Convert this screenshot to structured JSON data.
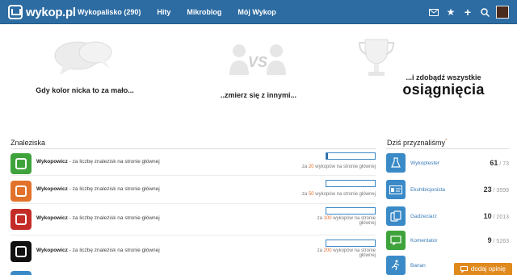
{
  "header": {
    "logo": "wykop.pl",
    "nav": [
      "Wykopalisko (290)",
      "Hity",
      "Mikroblog",
      "Mój Wykop"
    ],
    "icons": [
      "mail-icon",
      "star-icon",
      "plus-icon",
      "search-icon",
      "avatar"
    ]
  },
  "hero": {
    "caption1": "Gdy kolor nicka to za mało...",
    "caption2": "..zmierz się z innymi...",
    "caption3_small": "...i zdobądź wszystkie",
    "caption3_big": "osiągnięcia",
    "vs_label": "VS"
  },
  "left": {
    "title": "Znaleziska",
    "rows": [
      {
        "name": "Wykopowicz",
        "desc": " - za liczbę znalezisk na stronie głównej",
        "pre": "za ",
        "num": "20",
        "post": " wykopów na stronie głównej",
        "progress": 0.03,
        "color": "#3fa33b"
      },
      {
        "name": "Wykopowicz",
        "desc": " - za liczbę znalezisk na stronie głównej",
        "pre": "za ",
        "num": "50",
        "post": " wykopów na stronie głównej",
        "progress": 0.0,
        "color": "#e2722b"
      },
      {
        "name": "Wykopowicz",
        "desc": " - za liczbę znalezisk na stronie głównej",
        "pre": "za ",
        "num": "100",
        "post": " wykopów na stronie głównej",
        "progress": 0.0,
        "color": "#c42c27"
      },
      {
        "name": "Wykopowicz",
        "desc": " - za liczbę znalezisk na stronie głównej",
        "pre": "za ",
        "num": "200",
        "post": " wykopów na stronie głównej",
        "progress": 0.0,
        "color": "#111111"
      }
    ]
  },
  "right": {
    "title": "Dziś przyznaliśmy",
    "asterisk": "*",
    "rows": [
      {
        "name": "Wykoptester",
        "count": "61",
        "total": "/ 73",
        "icon": "flask-icon"
      },
      {
        "name": "Ekshibicjonista",
        "count": "23",
        "total": "/ 3599",
        "icon": "id-card-icon"
      },
      {
        "name": "Gadżeciarz",
        "count": "10",
        "total": "/ 2013",
        "icon": "devices-icon"
      },
      {
        "name": "Komentator",
        "count": "9",
        "total": "/ 5263",
        "icon": "comment-icon"
      },
      {
        "name": "Banan",
        "count": "",
        "total": "",
        "icon": "runner-icon"
      }
    ]
  },
  "feedback": {
    "label": "dodaj opinię"
  }
}
